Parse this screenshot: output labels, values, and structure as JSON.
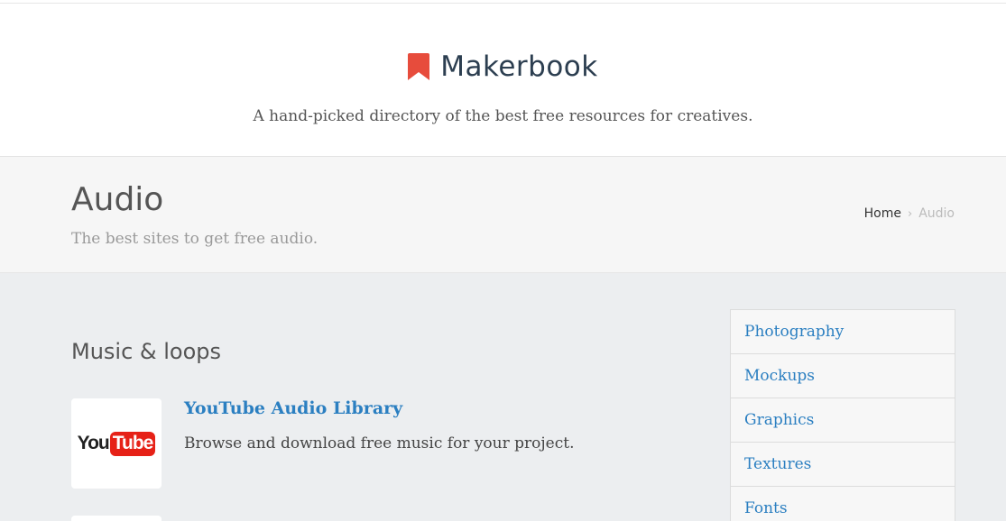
{
  "header": {
    "brand_name": "Makerbook",
    "tagline": "A hand-picked directory of the best free resources for creatives.",
    "brand_color": "#e74c3c"
  },
  "page": {
    "title": "Audio",
    "subtitle": "The best sites to get free audio.",
    "breadcrumb": {
      "home": "Home",
      "separator": "›",
      "current": "Audio"
    }
  },
  "section": {
    "title": "Music & loops",
    "items": [
      {
        "title": "YouTube Audio Library",
        "description": "Browse and download free music for your project.",
        "logo": {
          "you": "You",
          "tube": "Tube"
        }
      }
    ]
  },
  "sidebar": {
    "items": [
      {
        "label": "Photography"
      },
      {
        "label": "Mockups"
      },
      {
        "label": "Graphics"
      },
      {
        "label": "Textures"
      },
      {
        "label": "Fonts"
      }
    ]
  }
}
